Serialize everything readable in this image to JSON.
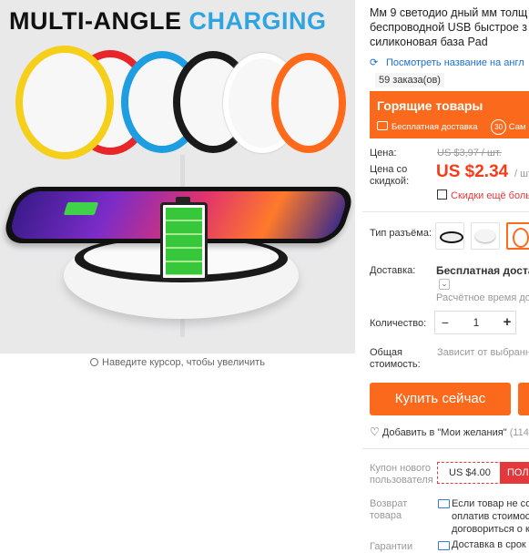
{
  "image": {
    "title_part1": "MULTI-ANGLE",
    "title_part2": "CHARGING",
    "zoom_hint": "Наведите курсор, чтобы увеличить",
    "ring_colors": [
      "#f5cf1a",
      "#e8262a",
      "#1e9ee0",
      "#1a1a1a",
      "#ffffff",
      "#ff6a1a"
    ]
  },
  "product": {
    "title_lines": [
      "Мм 9 светодио дный мм толщ",
      "беспроводной USB быстрое з",
      "силиконовая база Pad"
    ],
    "translate_link": "Посмотреть название на англ",
    "orders": "59 заказа(ов)"
  },
  "promo": {
    "title": "Горящие товары",
    "free_delivery": "Бесплатная доставка",
    "days_badge": "30",
    "days_text": "Сам"
  },
  "price": {
    "price_label": "Цена:",
    "old_price": "US $3,97 / шт.",
    "discount_label": "Цена со скидкой:",
    "new_price": "US $2.34",
    "unit": "/ шт",
    "discount_note": "Скидки ещё больш"
  },
  "options": {
    "connector_label": "Тип разъёма:",
    "delivery_label": "Доставка:",
    "delivery_value": "Бесплатная доставк",
    "delivery_time": "Расчётное время дос",
    "quantity_label": "Количество:",
    "quantity_value": "1",
    "minus": "−",
    "plus": "+",
    "total_label": "Общая стоимость:",
    "total_value": "Зависит от выбранн"
  },
  "actions": {
    "buy_now": "Купить сейчас",
    "wishlist": "Добавить в \"Мои желания\"",
    "wishlist_count": "(114"
  },
  "coupon": {
    "label": "Купон нового пользователя",
    "value": "US $4.00",
    "get": "ПОЛ"
  },
  "return": {
    "label": "Возврат товара",
    "text_lines": [
      "Если товар не сос",
      "оплатив стоимост",
      "договориться о к"
    ]
  },
  "guarantee": {
    "label": "Гарантии",
    "text": "Доставка в срок"
  }
}
